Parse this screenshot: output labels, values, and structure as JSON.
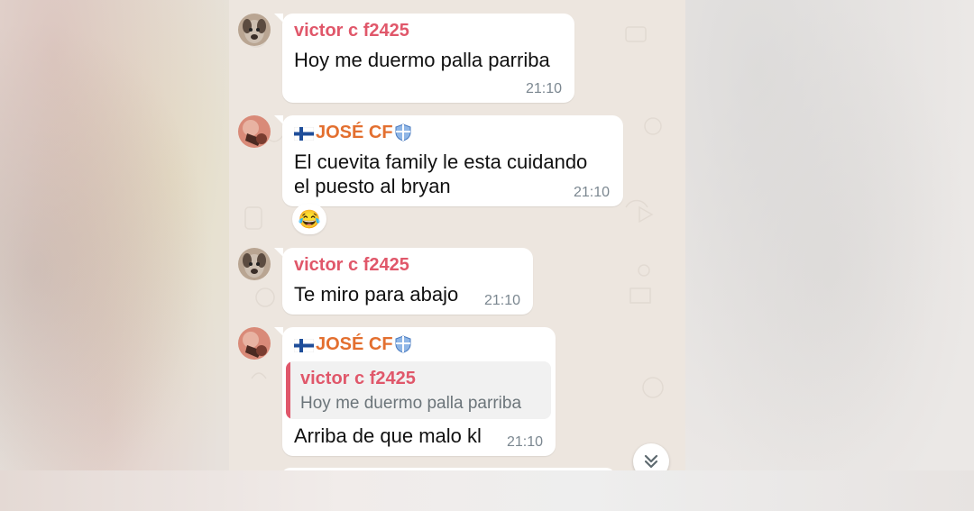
{
  "messages": [
    {
      "sender": "victor c f2425",
      "text_lines": [
        "Hoy me duermo palla parriba"
      ],
      "time": "21:10"
    },
    {
      "sender": "JOSÉ CF",
      "text_lines": [
        "El cuevita family le esta cuidando",
        "el puesto al bryan"
      ],
      "time": "21:10",
      "reaction": "😂"
    },
    {
      "sender": "victor c f2425",
      "text_lines": [
        "Te miro para abajo"
      ],
      "time": "21:10"
    },
    {
      "sender": "JOSÉ CF",
      "reply_to": {
        "sender": "victor c f2425",
        "text": "Hoy me duermo palla parriba"
      },
      "text_lines": [
        "Arriba de que malo kl"
      ],
      "time": "21:10"
    }
  ],
  "colors": {
    "victor_name": "#e0576a",
    "jose_name": "#e36f2f",
    "bubble": "#ffffff",
    "chat_background": "#ede6df",
    "timestamp": "#7b8790"
  },
  "icons": {
    "jose_prefix": "finland-flag-icon",
    "jose_suffix": "shield-icon",
    "scroll_down": "chevron-double-down-icon"
  }
}
